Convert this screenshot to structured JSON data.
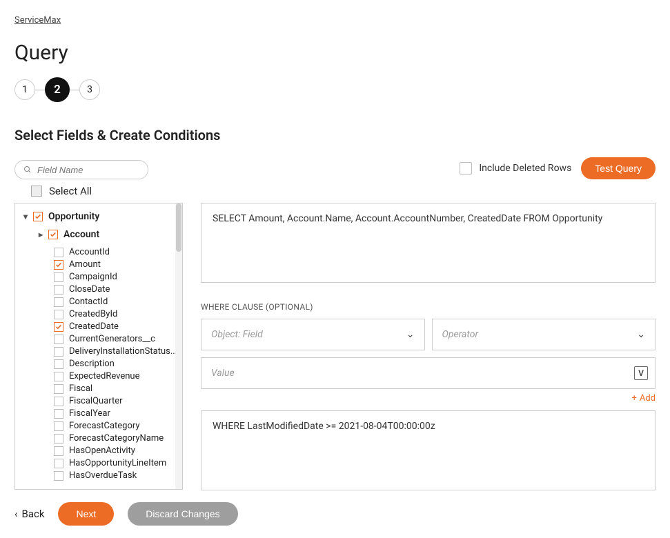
{
  "breadcrumb": "ServiceMax",
  "title": "Query",
  "steps": [
    "1",
    "2",
    "3"
  ],
  "active_step_index": 1,
  "section_title": "Select Fields & Create Conditions",
  "search": {
    "placeholder": "Field Name"
  },
  "include_deleted_label": "Include Deleted Rows",
  "test_query_label": "Test Query",
  "select_all_label": "Select All",
  "tree": {
    "root": {
      "label": "Opportunity",
      "checked": true
    },
    "child": {
      "label": "Account",
      "checked": true
    },
    "fields": [
      {
        "label": "AccountId",
        "checked": false
      },
      {
        "label": "Amount",
        "checked": true
      },
      {
        "label": "CampaignId",
        "checked": false
      },
      {
        "label": "CloseDate",
        "checked": false
      },
      {
        "label": "ContactId",
        "checked": false
      },
      {
        "label": "CreatedById",
        "checked": false
      },
      {
        "label": "CreatedDate",
        "checked": true
      },
      {
        "label": "CurrentGenerators__c",
        "checked": false
      },
      {
        "label": "DeliveryInstallationStatus...",
        "checked": false
      },
      {
        "label": "Description",
        "checked": false
      },
      {
        "label": "ExpectedRevenue",
        "checked": false
      },
      {
        "label": "Fiscal",
        "checked": false
      },
      {
        "label": "FiscalQuarter",
        "checked": false
      },
      {
        "label": "FiscalYear",
        "checked": false
      },
      {
        "label": "ForecastCategory",
        "checked": false
      },
      {
        "label": "ForecastCategoryName",
        "checked": false
      },
      {
        "label": "HasOpenActivity",
        "checked": false
      },
      {
        "label": "HasOpportunityLineItem",
        "checked": false
      },
      {
        "label": "HasOverdueTask",
        "checked": false
      }
    ]
  },
  "sql_text": "SELECT Amount, Account.Name, Account.AccountNumber, CreatedDate FROM Opportunity",
  "where": {
    "label": "WHERE CLAUSE (OPTIONAL)",
    "object_placeholder": "Object: Field",
    "operator_placeholder": "Operator",
    "value_placeholder": "Value",
    "value_badge": "V",
    "add_label": "Add",
    "result_text": "WHERE LastModifiedDate >= 2021-08-04T00:00:00z"
  },
  "footer": {
    "back": "Back",
    "next": "Next",
    "discard": "Discard Changes"
  }
}
